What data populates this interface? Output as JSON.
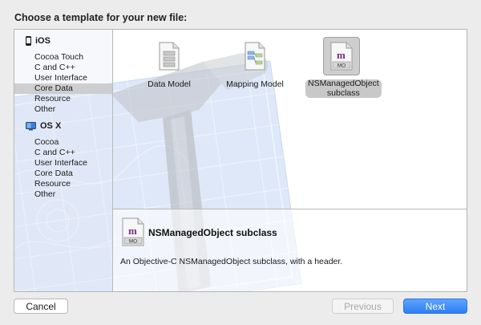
{
  "dialog": {
    "title": "Choose a template for your new file:"
  },
  "sidebar": {
    "groups": [
      {
        "name": "iOS",
        "icon": "iphone-icon",
        "items": [
          "Cocoa Touch",
          "C and C++",
          "User Interface",
          "Core Data",
          "Resource",
          "Other"
        ]
      },
      {
        "name": "OS X",
        "icon": "osx-finder-icon",
        "items": [
          "Cocoa",
          "C and C++",
          "User Interface",
          "Core Data",
          "Resource",
          "Other"
        ]
      }
    ],
    "selected": "Core Data"
  },
  "templates": [
    {
      "label": "Data Model",
      "icon": "data-model-file-icon"
    },
    {
      "label": "Mapping Model",
      "icon": "mapping-model-file-icon"
    },
    {
      "label": "NSManagedObject subclass",
      "icon": "managed-object-file-icon",
      "badge": "MO",
      "selected": true
    }
  ],
  "detail": {
    "title": "NSManagedObject subclass",
    "description": "An Objective-C NSManagedObject subclass, with a header.",
    "icon_badge": "MO"
  },
  "buttons": {
    "cancel": "Cancel",
    "previous": "Previous",
    "next": "Next"
  },
  "colors": {
    "accent": "#2d7ff7",
    "selection": "#c8c8c8",
    "blueprint": "#7fa6e0"
  }
}
